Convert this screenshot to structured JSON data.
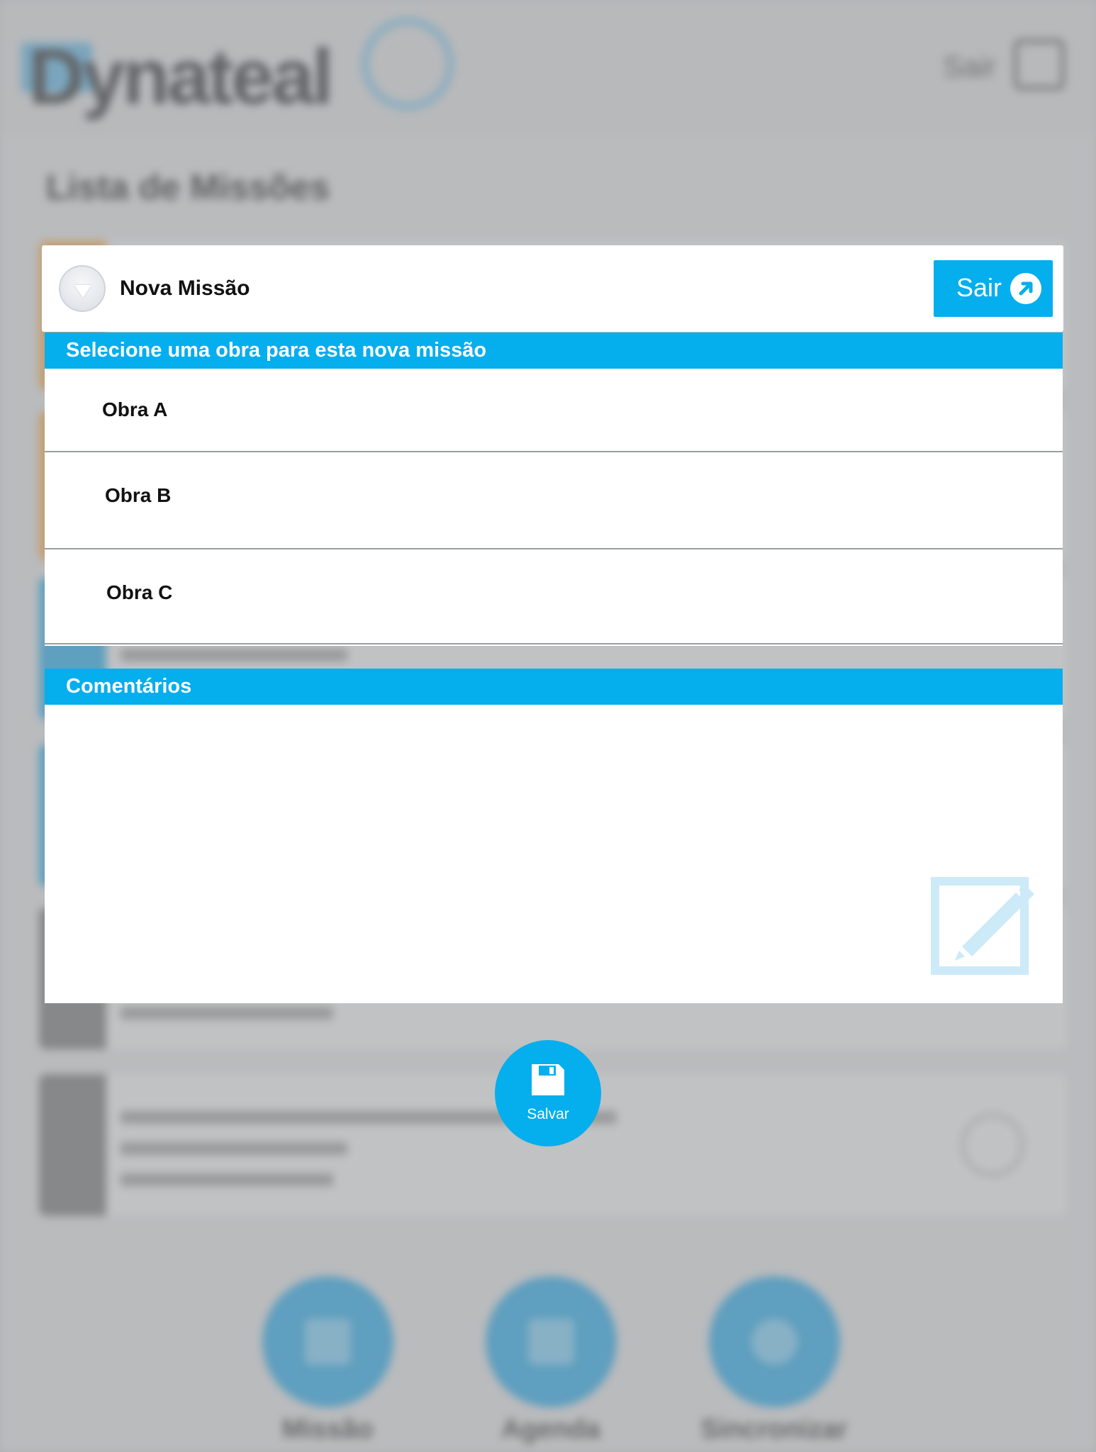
{
  "background": {
    "brand": "Dynateal",
    "header_exit_label": "Sair",
    "page_title": "Lista de Missões",
    "nav": [
      {
        "label": "Missão"
      },
      {
        "label": "Agenda"
      },
      {
        "label": "Sincronizar"
      }
    ]
  },
  "modal": {
    "title": "Nova Missão",
    "exit_label": "Sair",
    "obras_header": "Selecione uma obra para esta nova missão",
    "obras": [
      "Obra A",
      "Obra B",
      "Obra C"
    ],
    "comments_header": "Comentários",
    "comments_value": "",
    "save_label": "Salvar"
  },
  "colors": {
    "accent": "#05aeed",
    "overlay": "#96989c",
    "header_text": "#ffffff"
  },
  "icons": {
    "toggle": "chevron-down-icon",
    "exit": "exit-arrow-icon",
    "edit": "edit-icon",
    "save": "floppy-disk-icon"
  }
}
